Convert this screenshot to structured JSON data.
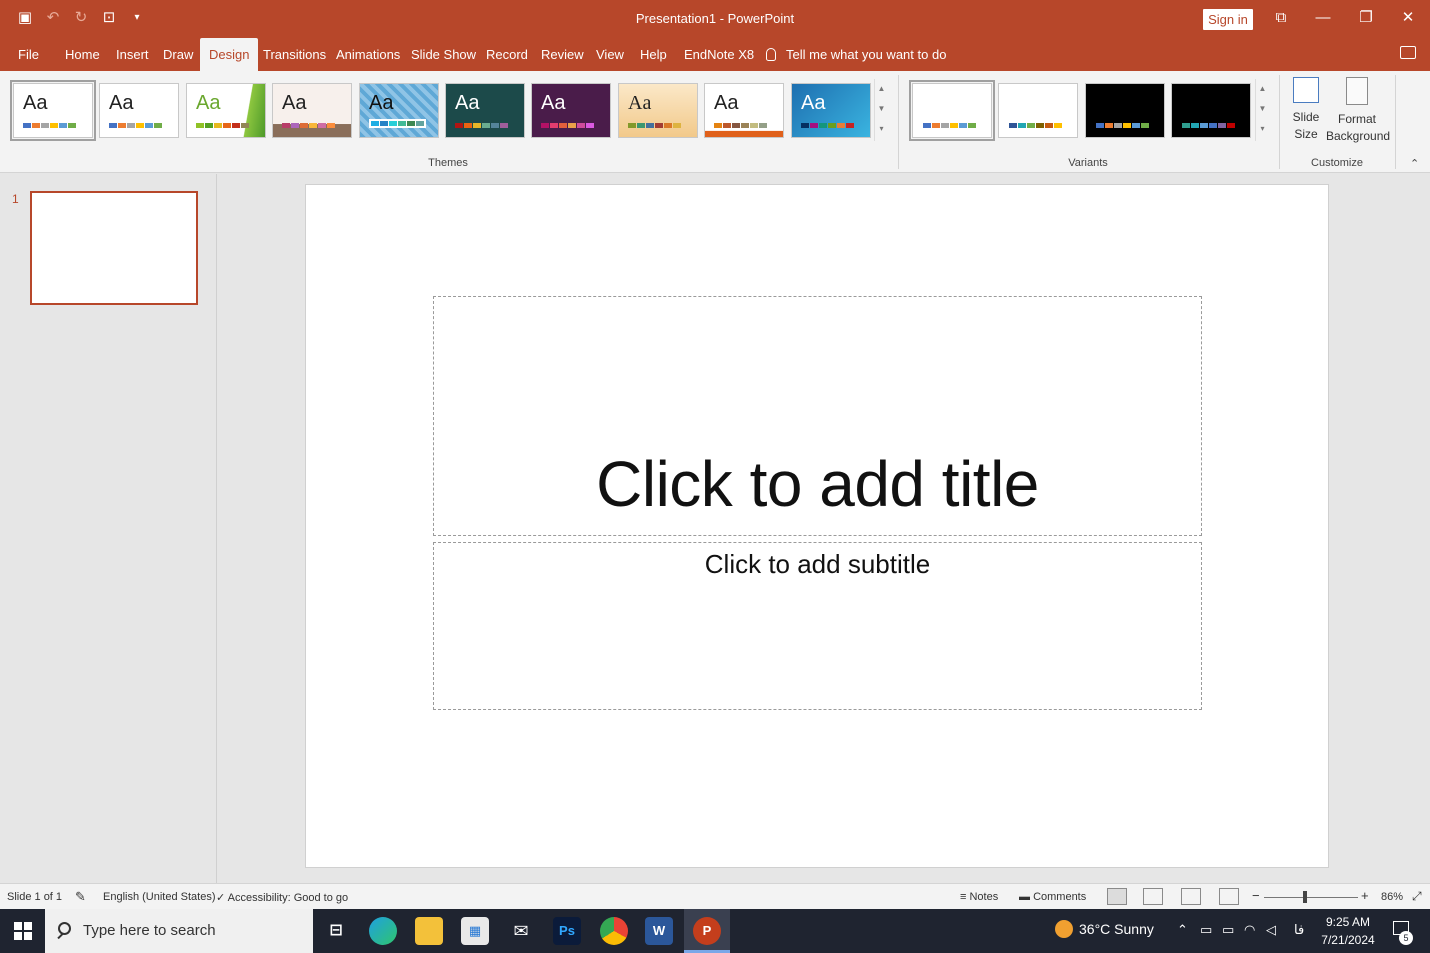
{
  "window": {
    "title": "Presentation1  -  PowerPoint",
    "sign_in": "Sign in"
  },
  "tabs": [
    "File",
    "Home",
    "Insert",
    "Draw",
    "Design",
    "Transitions",
    "Animations",
    "Slide Show",
    "Record",
    "Review",
    "View",
    "Help",
    "EndNote X8"
  ],
  "active_tab": "Design",
  "tell_me": "Tell me what you want to do",
  "ribbon": {
    "themes_label": "Themes",
    "variants_label": "Variants",
    "customize_label": "Customize",
    "theme_sample_text": "Aa",
    "slide_size": "Slide Size",
    "format_background": "Format Background"
  },
  "slide": {
    "number": "1",
    "title_placeholder": "Click to add title",
    "subtitle_placeholder": "Click to add subtitle"
  },
  "status": {
    "slide_count": "Slide 1 of 1",
    "language": "English (United States)",
    "accessibility": "Accessibility: Good to go",
    "notes": "Notes",
    "comments": "Comments",
    "zoom": "86%"
  },
  "taskbar": {
    "search_placeholder": "Type here to search",
    "weather": "36°C  Sunny",
    "time": "9:25 AM",
    "date": "7/21/2024",
    "input_lang": "فا",
    "notification_count": "5"
  },
  "colors": {
    "accent": "#b7472a",
    "taskbar": "#1f2430"
  }
}
